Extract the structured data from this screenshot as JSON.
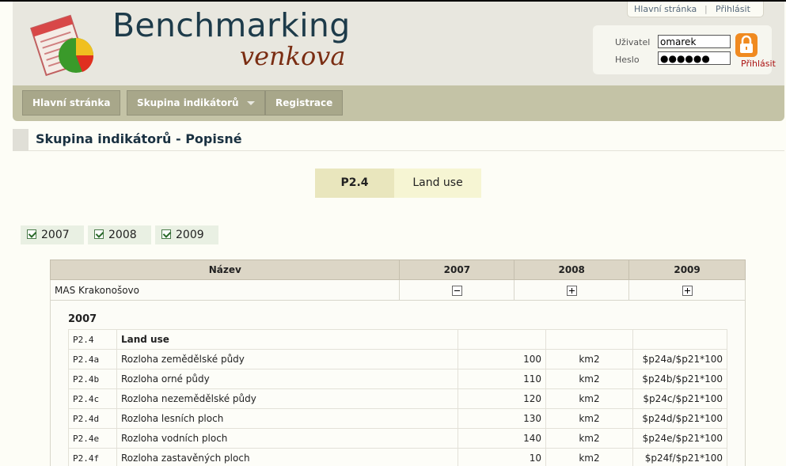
{
  "app": {
    "title_main": "Benchmarking",
    "title_sub": "venkova"
  },
  "toplinks": {
    "home": "Hlavní stránka",
    "separator": "|",
    "login": "Přihlásit"
  },
  "login": {
    "user_label": "Uživatel",
    "user_value": "omarek",
    "pass_label": "Heslo",
    "pass_value": "●●●●●●",
    "button_label": "Přihlásit"
  },
  "nav": {
    "home": "Hlavní stránka",
    "groups": "Skupina indikátorů",
    "register": "Registrace"
  },
  "page": {
    "title": "Skupina indikátorů - Popisné"
  },
  "indicator": {
    "code": "P2.4",
    "name": "Land use"
  },
  "year_filters": [
    "2007",
    "2008",
    "2009"
  ],
  "outer_table": {
    "headers": [
      "Název",
      "2007",
      "2008",
      "2009"
    ],
    "row": {
      "name": "MAS Krakonošovo"
    }
  },
  "detail": {
    "year": "2007",
    "rows": [
      {
        "code": "P2.4",
        "name": "Land use",
        "value": "",
        "unit": "",
        "formula": ""
      },
      {
        "code": "P2.4a",
        "name": "Rozloha zemědělské půdy",
        "value": "100",
        "unit": "km2",
        "formula": "$p24a/$p21*100"
      },
      {
        "code": "P2.4b",
        "name": "Rozloha orné půdy",
        "value": "110",
        "unit": "km2",
        "formula": "$p24b/$p21*100"
      },
      {
        "code": "P2.4c",
        "name": "Rozloha nezemědělské půdy",
        "value": "120",
        "unit": "km2",
        "formula": "$p24c/$p21*100"
      },
      {
        "code": "P2.4d",
        "name": "Rozloha lesních ploch",
        "value": "130",
        "unit": "km2",
        "formula": "$p24d/$p21*100"
      },
      {
        "code": "P2.4e",
        "name": "Rozloha vodních ploch",
        "value": "140",
        "unit": "km2",
        "formula": "$p24e/$p21*100"
      },
      {
        "code": "P2.4f",
        "name": "Rozloha zastavěných ploch",
        "value": "10",
        "unit": "km2",
        "formula": "$p24f/$p21*100"
      }
    ]
  }
}
